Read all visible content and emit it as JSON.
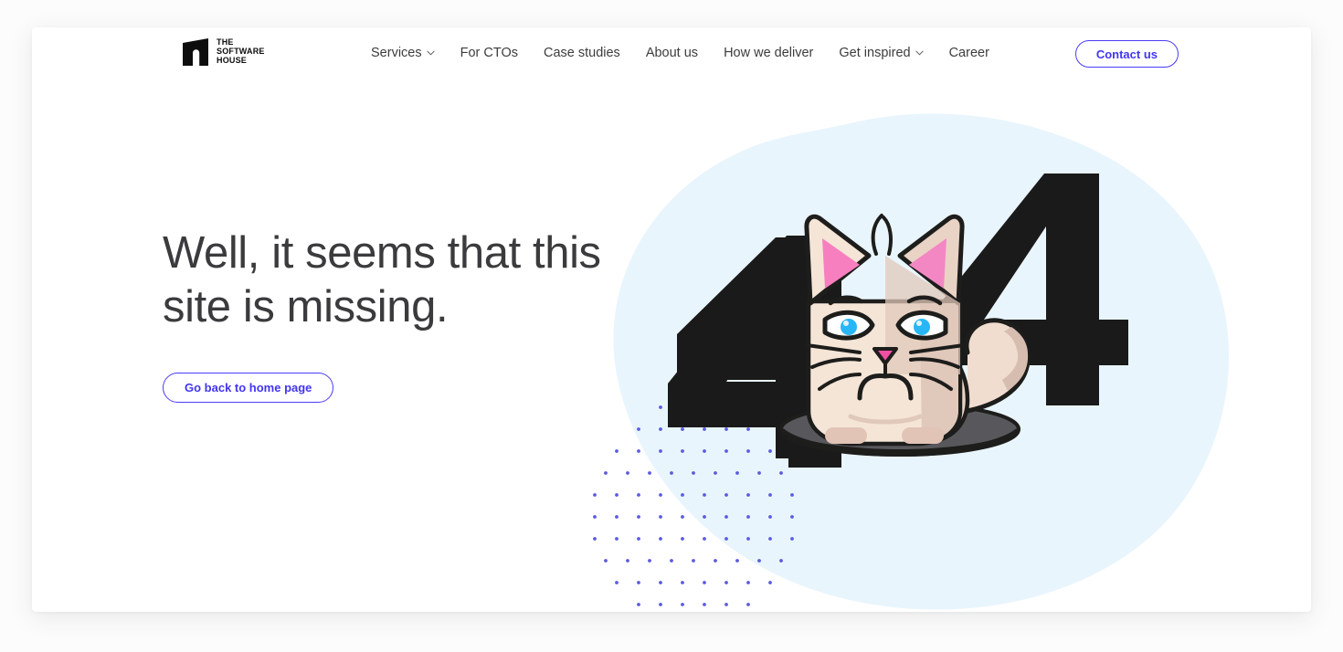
{
  "header": {
    "logo": {
      "name": "The Software House",
      "text": "THE\nSOFTWARE\nHOUSE",
      "icon": "software-house-logo-icon"
    },
    "nav": [
      {
        "label": "Services",
        "has_dropdown": true,
        "icon": "chevron-down-icon"
      },
      {
        "label": "For CTOs",
        "has_dropdown": false,
        "icon": ""
      },
      {
        "label": "Case studies",
        "has_dropdown": false,
        "icon": ""
      },
      {
        "label": "About us",
        "has_dropdown": false,
        "icon": ""
      },
      {
        "label": "How we deliver",
        "has_dropdown": false,
        "icon": ""
      },
      {
        "label": "Get inspired",
        "has_dropdown": true,
        "icon": "chevron-down-icon"
      },
      {
        "label": "Career",
        "has_dropdown": false,
        "icon": ""
      }
    ],
    "contact_button": "Contact us"
  },
  "hero": {
    "title": "Well, it seems that this site is missing.",
    "cta_label": "Go back to home page"
  },
  "illustration": {
    "name": "404-grumpy-cat-illustration",
    "error_code": "404",
    "digit_left": "4",
    "digit_right": "4",
    "character": "grumpy-cat-in-hole"
  },
  "colors": {
    "accent_blue": "#4235f0",
    "accent_border": "#4c3bf7",
    "blob_blue": "#e9f5fd",
    "dot_blue": "#5b5be0",
    "digit_black": "#1a1a1a",
    "hole_gray": "#58585c",
    "cat_fur_light": "#f5e5d7",
    "cat_fur_dark": "#d6bdb0",
    "cat_ear_pink": "#f77fc0",
    "cat_nose_pink": "#ef4fa5",
    "cat_eye_blue": "#29b6f6",
    "cat_outline": "#1d1d1b",
    "text_dark": "#3b3b3d",
    "nav_text": "#3c3c3c",
    "page_bg": "#fcfcfc",
    "card_bg": "#ffffff"
  }
}
